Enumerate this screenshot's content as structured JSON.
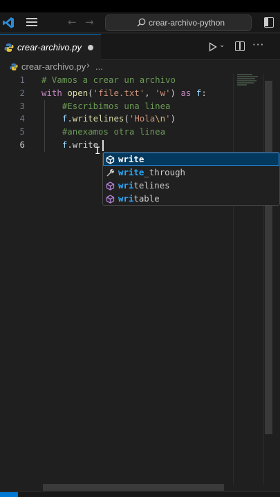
{
  "window": {
    "search_text": "crear-archivo-python"
  },
  "tab": {
    "label": "crear-archivo.py"
  },
  "breadcrumb": {
    "file": "crear-archivo.py",
    "separator": "›",
    "more": "..."
  },
  "editor": {
    "active_line": 6,
    "lines": [
      {
        "num": "1",
        "tokens": [
          {
            "t": "# Vamos a crear un archivo",
            "c": "comment"
          }
        ]
      },
      {
        "num": "2",
        "tokens": [
          {
            "t": "with",
            "c": "kw"
          },
          {
            "t": " ",
            "c": "op"
          },
          {
            "t": "open",
            "c": "fn"
          },
          {
            "t": "(",
            "c": "op"
          },
          {
            "t": "'file.txt'",
            "c": "str"
          },
          {
            "t": ", ",
            "c": "op"
          },
          {
            "t": "'w'",
            "c": "str"
          },
          {
            "t": ") ",
            "c": "op"
          },
          {
            "t": "as",
            "c": "kw"
          },
          {
            "t": " ",
            "c": "op"
          },
          {
            "t": "f",
            "c": "var"
          },
          {
            "t": ":",
            "c": "op"
          }
        ]
      },
      {
        "num": "3",
        "tokens": [
          {
            "t": "    ",
            "c": "op"
          },
          {
            "t": "#Escribimos una linea",
            "c": "comment"
          }
        ]
      },
      {
        "num": "4",
        "tokens": [
          {
            "t": "    ",
            "c": "op"
          },
          {
            "t": "f",
            "c": "var"
          },
          {
            "t": ".",
            "c": "op"
          },
          {
            "t": "writelines",
            "c": "fn"
          },
          {
            "t": "(",
            "c": "op"
          },
          {
            "t": "'Hola",
            "c": "str"
          },
          {
            "t": "\\n",
            "c": "esc"
          },
          {
            "t": "'",
            "c": "str"
          },
          {
            "t": ")",
            "c": "op"
          }
        ]
      },
      {
        "num": "5",
        "tokens": [
          {
            "t": "    ",
            "c": "op"
          },
          {
            "t": "#anexamos otra linea",
            "c": "comment"
          }
        ]
      },
      {
        "num": "6",
        "tokens": [
          {
            "t": "    ",
            "c": "op"
          },
          {
            "t": "f",
            "c": "var"
          },
          {
            "t": ".",
            "c": "op"
          },
          {
            "t": "write",
            "c": "op"
          }
        ]
      }
    ]
  },
  "suggestions": [
    {
      "match": "write",
      "rest": "",
      "kind": "method",
      "selected": true
    },
    {
      "match": "write",
      "rest": "_through",
      "kind": "property",
      "selected": false
    },
    {
      "match": "wri",
      "rest": "telines",
      "kind": "method",
      "selected": false
    },
    {
      "match": "wri",
      "rest": "table",
      "kind": "method",
      "selected": false
    }
  ],
  "colors": {
    "comment": "#6a9955",
    "keyword": "#c586c0",
    "function": "#dcdcaa",
    "variable": "#9cdcfe",
    "string": "#ce9178",
    "accent": "#0078d4",
    "suggest_highlight": "#2aaaff"
  }
}
